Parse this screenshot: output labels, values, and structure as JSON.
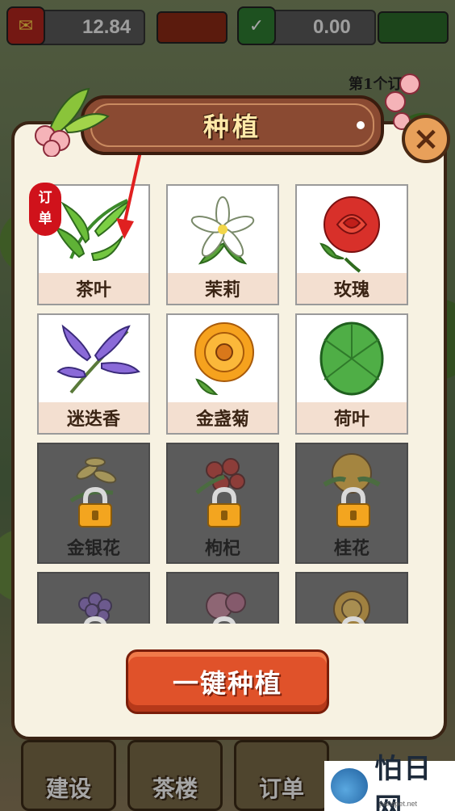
{
  "currencies": [
    {
      "name": "red-packet",
      "value": "12.84",
      "color": "#b3261e"
    },
    {
      "name": "wechat",
      "value": "0.00",
      "color": "#2e7d32"
    }
  ],
  "header_partial_text": "第1个订",
  "modal": {
    "title": "种植",
    "order_badge": "订单",
    "close_icon": "close-icon",
    "plants": [
      {
        "label": "茶叶",
        "icon": "tea-leaf-icon",
        "locked": false
      },
      {
        "label": "茉莉",
        "icon": "jasmine-icon",
        "locked": false
      },
      {
        "label": "玫瑰",
        "icon": "rose-icon",
        "locked": false
      },
      {
        "label": "迷迭香",
        "icon": "rosemary-icon",
        "locked": false
      },
      {
        "label": "金盏菊",
        "icon": "calendula-icon",
        "locked": false
      },
      {
        "label": "荷叶",
        "icon": "lotus-leaf-icon",
        "locked": false
      },
      {
        "label": "金银花",
        "icon": "honeysuckle-icon",
        "locked": true
      },
      {
        "label": "枸杞",
        "icon": "goji-icon",
        "locked": true
      },
      {
        "label": "桂花",
        "icon": "osmanthus-icon",
        "locked": true
      },
      {
        "label": "",
        "icon": "lavender-icon",
        "locked": true
      },
      {
        "label": "",
        "icon": "flower-icon",
        "locked": true
      },
      {
        "label": "",
        "icon": "chrysanthemum-icon",
        "locked": true
      }
    ],
    "one_click_label": "一键种植"
  },
  "bottom_nav": [
    {
      "label": "建设"
    },
    {
      "label": "茶楼"
    },
    {
      "label": "订单"
    }
  ],
  "watermark": {
    "text": "怕日网",
    "sub": "parispet.net"
  },
  "colors": {
    "accent": "#e0522a",
    "panel": "#f7f2e2",
    "ribbon": "#8a4a32"
  }
}
